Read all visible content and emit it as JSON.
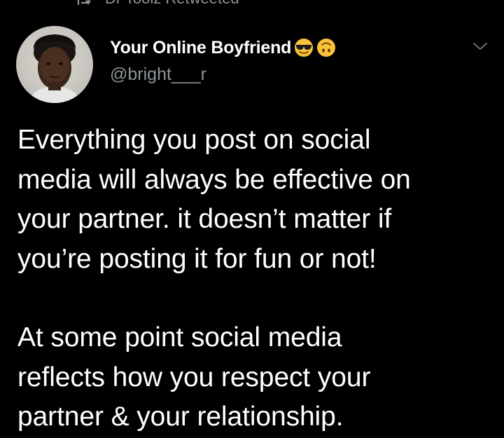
{
  "retweet": {
    "text": "Dr Toolz Retweeted",
    "icon": "retweet-icon"
  },
  "author": {
    "display_name": "Your Online Boyfriend",
    "emojis": [
      "smiling-face-with-sunglasses-icon",
      "upside-down-face-icon"
    ],
    "handle": "@bright___r",
    "avatar": "avatar-photo"
  },
  "menu": {
    "icon": "chevron-down-icon"
  },
  "tweet": {
    "paragraph_1": "Everything you post on social\nmedia will always be effective on\nyour partner. it doesn’t matter if\nyou’re posting it for fun or not!",
    "paragraph_2": "At some point social media\nreflects how you respect your\npartner & your relationship."
  },
  "colors": {
    "background": "#000000",
    "text_primary": "#ffffff",
    "text_secondary": "#8e9499",
    "emoji_yellow": "#f7c23a"
  }
}
